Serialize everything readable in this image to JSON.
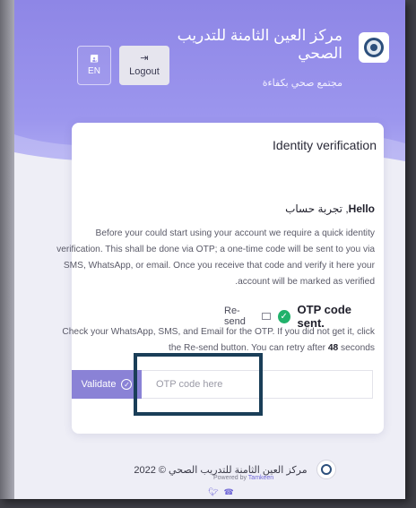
{
  "header": {
    "org_name": "مركز العين الثامنة للتدريب الصحي",
    "tagline": "مجتمع صحي بكفاءة",
    "lang_button_label": "EN",
    "logout_label": "Logout"
  },
  "card": {
    "title": "Identity verification",
    "hello_prefix": "Hello",
    "hello_name": ", تجربة حساب",
    "intro": "Before your could start using your account we require a quick identity verification. This shall be done via OTP; a one-time code will be sent to you via SMS, WhatsApp, or email. Once you receive that code and verify it here your account will be marked as verified.",
    "otp_title": "OTP code sent.",
    "resend_label": "Re-send",
    "otp_note_part1": "Check your WhatsApp, SMS, and Email for the OTP. If you did not get it, click the Re-send button. You can retry after",
    "retry_seconds": "48",
    "otp_note_part2": "seconds",
    "validate_label": "Validate",
    "otp_placeholder": "OTP code here",
    "otp_value": ""
  },
  "footer": {
    "copyright": "مركز العين الثامنة للتدريب الصحي © 2022",
    "powered_prefix": "Powered by",
    "powered_brand": "Tamkeen"
  },
  "colors": {
    "hero": "#9c96ee",
    "accent": "#8a82d6",
    "success": "#21b26b",
    "highlight": "#1a3e58"
  },
  "icons": [
    "translate-icon",
    "logout-icon",
    "check-circle-icon",
    "mail-icon",
    "twitter-icon",
    "whatsapp-icon"
  ]
}
